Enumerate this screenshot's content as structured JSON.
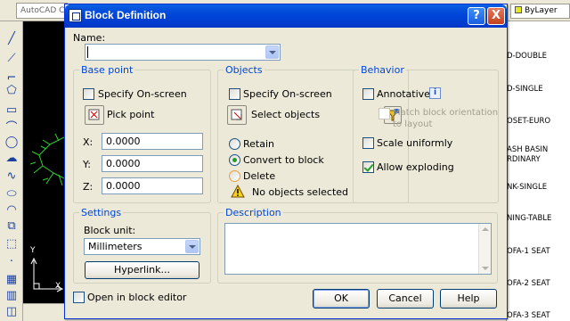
{
  "background": {
    "tab_label": "AutoCAD C",
    "layer_combo": "ByLayer",
    "palette_items": [
      "D-DOUBLE",
      "D-SINGLE",
      "OSET-EURO",
      "ASH BASIN\nRDINARY",
      "NK-SINGLE",
      "NING-TABLE",
      "OFA-1 SEAT",
      "OFA-2 SEAT",
      "OFA-3 SEAT"
    ],
    "ucs_x": "X",
    "ucs_y": "Y"
  },
  "dialog": {
    "title": "Block Definition",
    "help_caption": "?",
    "close_caption": "X",
    "name_label": "Name:",
    "name_value": "",
    "base_point": {
      "title": "Base point",
      "specify_onscreen": "Specify On-screen",
      "specify_checked": false,
      "pick_point": "Pick point",
      "x_label": "X:",
      "x_value": "0.0000",
      "y_label": "Y:",
      "y_value": "0.0000",
      "z_label": "Z:",
      "z_value": "0.0000"
    },
    "objects": {
      "title": "Objects",
      "specify_onscreen": "Specify On-screen",
      "specify_checked": false,
      "select_objects": "Select objects",
      "retain": "Retain",
      "convert": "Convert to block",
      "delete": "Delete",
      "selected_option": "convert",
      "status": "No objects selected"
    },
    "behavior": {
      "title": "Behavior",
      "annotative": "Annotative",
      "annotative_checked": false,
      "info_icon": "i",
      "match_orientation": "Match block orientation\nto layout",
      "scale_uniformly": "Scale uniformly",
      "scale_checked": false,
      "allow_exploding": "Allow exploding",
      "exploding_checked": true
    },
    "settings": {
      "title": "Settings",
      "block_unit_label": "Block unit:",
      "block_unit_value": "Millimeters",
      "hyperlink": "Hyperlink..."
    },
    "description": {
      "title": "Description",
      "value": ""
    },
    "open_in_editor": "Open in block editor",
    "open_checked": false,
    "ok": "OK",
    "cancel": "Cancel",
    "help": "Help"
  }
}
